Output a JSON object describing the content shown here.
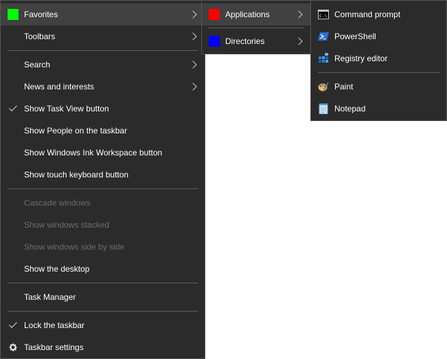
{
  "main_menu": {
    "favorites": {
      "label": "Favorites",
      "swatch_color": "#00ff00"
    },
    "toolbars": {
      "label": "Toolbars"
    },
    "search": {
      "label": "Search"
    },
    "news": {
      "label": "News and interests"
    },
    "task_view": {
      "label": "Show Task View button",
      "checked": true
    },
    "people": {
      "label": "Show People on the taskbar"
    },
    "ink": {
      "label": "Show Windows Ink Workspace button"
    },
    "touch_keyboard": {
      "label": "Show touch keyboard button"
    },
    "cascade": {
      "label": "Cascade windows",
      "disabled": true
    },
    "stacked": {
      "label": "Show windows stacked",
      "disabled": true
    },
    "side_by_side": {
      "label": "Show windows side by side",
      "disabled": true
    },
    "desktop": {
      "label": "Show the desktop"
    },
    "task_manager": {
      "label": "Task Manager"
    },
    "lock": {
      "label": "Lock the taskbar",
      "checked": true
    },
    "settings": {
      "label": "Taskbar settings",
      "icon": "gear-icon"
    }
  },
  "favorites_submenu": {
    "applications": {
      "label": "Applications",
      "swatch_color": "#ff0000"
    },
    "directories": {
      "label": "Directories",
      "swatch_color": "#0000ff"
    }
  },
  "applications_submenu": {
    "cmd": {
      "label": "Command prompt",
      "icon": "command-prompt-icon"
    },
    "powershell": {
      "label": "PowerShell",
      "icon": "powershell-icon"
    },
    "regedit": {
      "label": "Registry editor",
      "icon": "registry-editor-icon"
    },
    "paint": {
      "label": "Paint",
      "icon": "paint-icon"
    },
    "notepad": {
      "label": "Notepad",
      "icon": "notepad-icon"
    }
  }
}
